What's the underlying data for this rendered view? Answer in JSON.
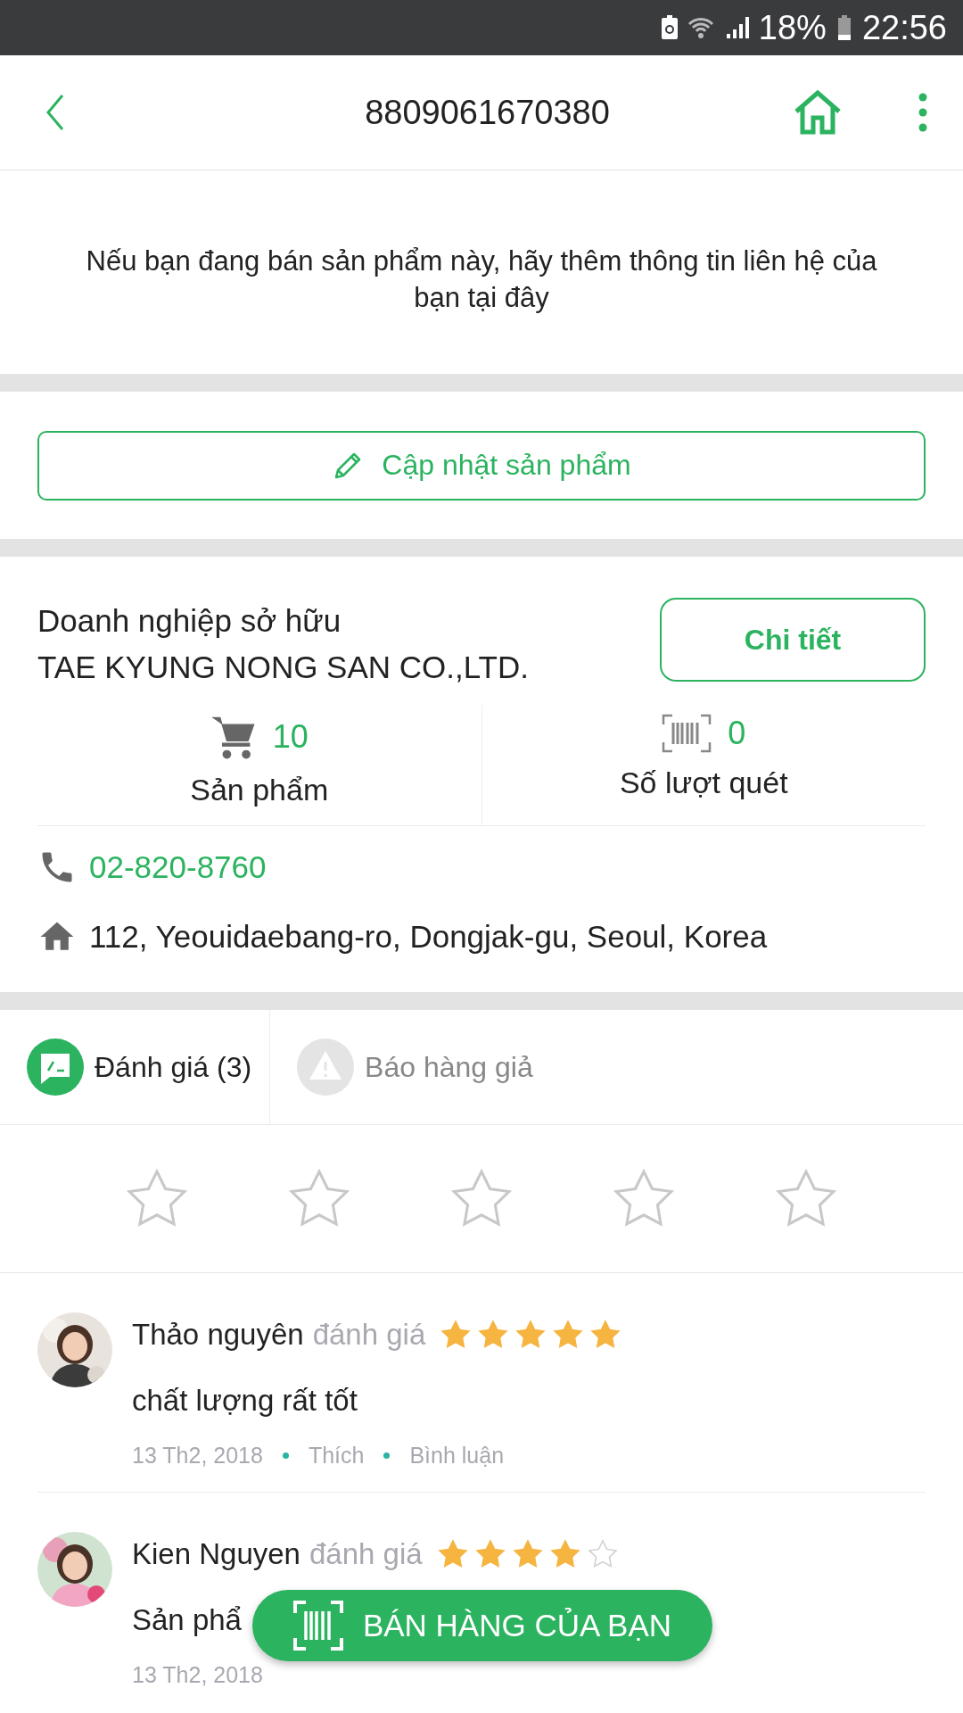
{
  "status_bar": {
    "battery": "18%",
    "time": "22:56"
  },
  "header": {
    "title": "8809061670380"
  },
  "notice": {
    "message": "Nếu bạn đang bán sản phẩm này, hãy thêm thông tin liên hệ của bạn tại đây"
  },
  "update_button": {
    "label": "Cập nhật sản phẩm"
  },
  "company": {
    "label": "Doanh nghiệp sở hữu",
    "name": "TAE KYUNG NONG SAN CO.,LTD.",
    "detail_button": "Chi tiết",
    "stats": [
      {
        "kind": "cart",
        "value": "10",
        "label": "Sản phẩm"
      },
      {
        "kind": "barcode",
        "value": "0",
        "label": "Số lượt quét"
      }
    ],
    "contacts": [
      {
        "kind": "phone",
        "text": "02-820-8760"
      },
      {
        "kind": "address",
        "text": "112, Yeouidaebang-ro, Dongjak-gu, Seoul, Korea"
      }
    ]
  },
  "tabs": [
    {
      "kind": "review",
      "label": "Đánh giá (3)",
      "selected": true
    },
    {
      "kind": "report",
      "label": "Báo hàng giả",
      "selected": false
    }
  ],
  "rating_input": {
    "stars": 0
  },
  "reviews": [
    {
      "name": "Thảo nguyên",
      "verb": "đánh giá",
      "stars": 5,
      "comment": "chất lượng rất tốt",
      "date": "13 Th2, 2018",
      "like": "Thích",
      "reply": "Bình luận"
    },
    {
      "name": "Kien Nguyen",
      "verb": "đánh giá",
      "stars": 4,
      "comment": "Sản phẩ",
      "date": "13 Th2, 2018"
    }
  ],
  "fab": {
    "label": "BÁN HÀNG CỦA BẠN"
  }
}
